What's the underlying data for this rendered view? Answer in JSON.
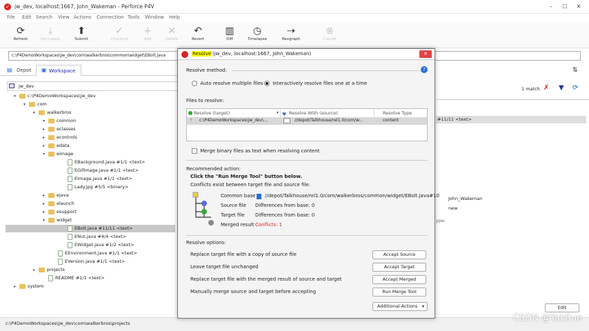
{
  "window": {
    "title": "jw_dev,  localhost:1667,  John_Wakeman - Perforce P4V",
    "controls": [
      "–",
      "☐",
      "✕"
    ]
  },
  "menu": [
    "File",
    "Edit",
    "Search",
    "View",
    "Actions",
    "Connection",
    "Tools",
    "Window",
    "Help"
  ],
  "toolbar": [
    {
      "label": "Refresh",
      "icon": "refresh-icon",
      "glyph": "⟳",
      "enabled": true
    },
    {
      "label": "Get Latest",
      "icon": "get-latest-icon",
      "glyph": "⤓",
      "enabled": false
    },
    {
      "label": "Submit",
      "icon": "submit-icon",
      "glyph": "⬆",
      "enabled": true
    },
    {
      "label": "Checkout",
      "icon": "checkout-icon",
      "glyph": "✓",
      "enabled": false
    },
    {
      "label": "Add",
      "icon": "add-icon",
      "glyph": "+",
      "enabled": false
    },
    {
      "label": "Delete",
      "icon": "delete-icon",
      "glyph": "✕",
      "enabled": false
    },
    {
      "label": "Revert",
      "icon": "revert-icon",
      "glyph": "↶",
      "enabled": true
    },
    {
      "label": "Diff",
      "icon": "diff-icon",
      "glyph": "▥",
      "enabled": true
    },
    {
      "label": "Timelapse",
      "icon": "timelapse-icon",
      "glyph": "◷",
      "enabled": true
    },
    {
      "label": "Revgraph",
      "icon": "revgraph-icon",
      "glyph": "⇢",
      "enabled": true
    },
    {
      "label": "Cancel",
      "icon": "cancel-icon",
      "glyph": "⊗",
      "enabled": false
    }
  ],
  "path": "c:\\P4DemoWorkspaces\\jw_dev\\com\\walkerbros\\common\\widget\\EBolt.java",
  "left": {
    "tabs": [
      "Depot",
      "Workspace"
    ],
    "workspace": "jw_dev",
    "tree": [
      {
        "label": "c:\\P4DemoWorkspaces\\jw_dev",
        "type": "folder",
        "exp": "▾"
      },
      {
        "label": "com",
        "type": "folder",
        "exp": "▾"
      },
      {
        "label": "walkerbros",
        "type": "folder",
        "exp": "▾"
      },
      {
        "label": "common",
        "type": "folder",
        "exp": "▾"
      },
      {
        "label": "eclasses",
        "type": "folder",
        "exp": "▸"
      },
      {
        "label": "econtrols",
        "type": "folder",
        "exp": "▸"
      },
      {
        "label": "edata",
        "type": "folder",
        "exp": "▸"
      },
      {
        "label": "eimage",
        "type": "folder",
        "exp": "▾"
      },
      {
        "label": "EBackground.java #1/1 <text>",
        "type": "file",
        "exp": ""
      },
      {
        "label": "EGifImage.java #1/1 <text>",
        "type": "file",
        "exp": ""
      },
      {
        "label": "EImage.java #1/1 <text>",
        "type": "file",
        "exp": ""
      },
      {
        "label": "Lady.jpg #5/5 <binary>",
        "type": "file",
        "exp": ""
      },
      {
        "label": "ejava",
        "type": "folder",
        "exp": "▸"
      },
      {
        "label": "elaunch",
        "type": "folder",
        "exp": "▸"
      },
      {
        "label": "esupport",
        "type": "folder",
        "exp": "▸"
      },
      {
        "label": "widget",
        "type": "folder",
        "exp": "▾"
      },
      {
        "label": "EBolt.java #11/11 <text>",
        "type": "file",
        "exp": "",
        "selected": true
      },
      {
        "label": "ENut.java #4/4 <text>",
        "type": "file",
        "exp": ""
      },
      {
        "label": "EWidget.java #1/2 <text>",
        "type": "file",
        "exp": ""
      },
      {
        "label": "EEnvironment.java #1/1 <text>",
        "type": "file",
        "exp": ""
      },
      {
        "label": "EVersion.java #1/1 <text>",
        "type": "file",
        "exp": ""
      },
      {
        "label": "projects",
        "type": "folder",
        "exp": "▸"
      },
      {
        "label": "README #1/1 <text>",
        "type": "file",
        "exp": ""
      },
      {
        "label": "system",
        "type": "folder",
        "exp": "▸"
      }
    ]
  },
  "right": {
    "match": "1 match",
    "row_text": "#11/11 <text>",
    "user": "John_Wakeman",
    "status": "new",
    "type_label": "ype:",
    "edit_btn": "Edit"
  },
  "status_path": "c:\\P4DemoWorkspaces\\jw_dev\\com\\walkerbros\\projects",
  "watermark": "CSDN @YakSue",
  "dialog": {
    "title_hl": "Resolve",
    "title_rest": "(jw_dev,  localhost:1667,  John_Wakeman)",
    "method_label": "Resolve method:",
    "method_auto": "Auto resolve multiple files",
    "method_interactive": "Interactively resolve files one at a time",
    "files_label": "Files to resolve:",
    "columns": [
      "Resolve (target)",
      "Resolve With (source)",
      "Resolve Type"
    ],
    "file_row": {
      "target": "c:\\P4DemoWorkspaces\\jw_dev\\...",
      "source": "//depot/Talkhouse/rel1.0/com/w...",
      "type": "content"
    },
    "merge_binary": "Merge binary files as text when resolving content",
    "recommended_label": "Recommended action:",
    "recommended_bold": "Click the \"Run Merge Tool\" button below.",
    "conflicts_text": "Conflicts exist between target file and source file.",
    "details": [
      {
        "k": "Common base",
        "v": "//depot/Talkhouse/rel1.0/com/walkerbros/common/widget/EBolt.java#10"
      },
      {
        "k": "Source file",
        "v": "Differences from base: 0"
      },
      {
        "k": "Target file",
        "v": "Differences from base: 0"
      },
      {
        "k": "Merged result",
        "v": "Conflicts: 1"
      }
    ],
    "options_label": "Resolve options:",
    "options": [
      {
        "text": "Replace target file with a copy of source file",
        "btn": "Accept Source"
      },
      {
        "text": "Leave target file unchanged",
        "btn": "Accept Target"
      },
      {
        "text": "Replace target file with the merged result of source and target",
        "btn": "Accept Merged"
      },
      {
        "text": "Manually merge source and target before accepting",
        "btn": "Run Merge Tool"
      }
    ],
    "additional": "Additional Actions",
    "help": "?"
  },
  "colors": {
    "accent": "#2a6fd6",
    "conflict": "#d42020",
    "close": "#e04343",
    "highlight": "#ffff00"
  }
}
